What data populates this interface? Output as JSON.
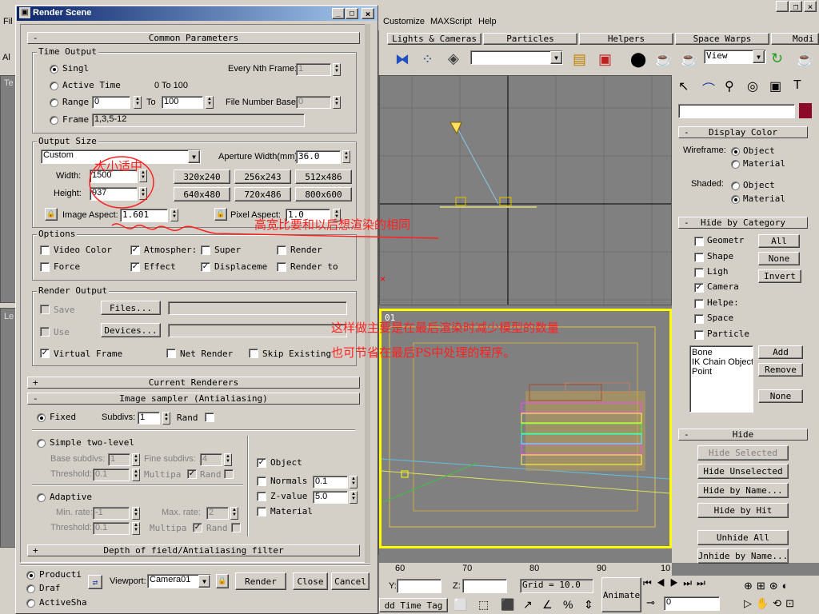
{
  "menu_items": [
    "Customize",
    "MAXScript",
    "Help"
  ],
  "app_left": {
    "file_stub": "Fil",
    "all_stub": "Al",
    "t_stub": "Te",
    "l_stub": "Le"
  },
  "tabs": [
    "Lights & Cameras",
    "Particles",
    "Helpers",
    "Space Warps",
    "Modi"
  ],
  "view_dropdown": "View",
  "main_buttons": {
    "minimize": "_",
    "restore": "❐",
    "close": "×"
  },
  "dialog": {
    "title": "Render Scene",
    "common_rollout": "Common Parameters",
    "time_output": {
      "title": "Time Output",
      "single": "Singl",
      "every_nth_label": "Every Nth Frame:",
      "every_nth_value": "1",
      "active_time": "Active Time",
      "active_range": "0 To 100",
      "range": "Range",
      "range_from": "0",
      "to_label": "To",
      "range_to": "100",
      "file_number_label": "File Number Base:",
      "file_number_value": "0",
      "frames": "Frame",
      "frames_value": "1,3,5-12"
    },
    "output_size": {
      "title": "Output Size",
      "preset": "Custom",
      "aperture_label": "Aperture Width(mm):",
      "aperture_value": "36.0",
      "width_label": "Width:",
      "width_value": "1500",
      "height_label": "Height:",
      "height_value": "937",
      "presets": [
        "320x240",
        "256x243",
        "512x486",
        "640x480",
        "720x486",
        "800x600"
      ],
      "image_aspect_label": "Image Aspect:",
      "image_aspect_value": "1.601",
      "pixel_aspect_label": "Pixel Aspect:",
      "pixel_aspect_value": "1.0"
    },
    "options": {
      "title": "Options",
      "items": [
        "Video Color",
        "Atmospher:",
        "Super",
        "Render",
        "Force",
        "Effect",
        "Displaceme",
        "Render to"
      ]
    },
    "render_output": {
      "title": "Render Output",
      "save": "Save",
      "files": "Files...",
      "use": "Use",
      "devices": "Devices...",
      "virtual_frame": "Virtual Frame",
      "net_render": "Net Render",
      "skip_existing": "Skip Existing"
    },
    "current_renderers": "Current Renderers",
    "image_sampler": {
      "title": "Image sampler (Antialiasing)",
      "fixed": "Fixed",
      "subdivs_label": "Subdivs:",
      "subdivs_value": "1",
      "rand": "Rand",
      "simple_two_level": "Simple two-level",
      "base_subdivs_label": "Base subdivs:",
      "base_subdivs_value": "1",
      "fine_subdivs_label": "Fine subdivs:",
      "fine_subdivs_value": "4",
      "threshold_label": "Threshold:",
      "threshold_value": "0.1",
      "multipa": "Multipa",
      "rand2": "Rand",
      "adaptive": "Adaptive",
      "min_rate_label": "Min. rate:",
      "min_rate_value": "-1",
      "max_rate_label": "Max. rate:",
      "max_rate_value": "2",
      "threshold2_value": "0.1",
      "object": "Object",
      "normals": "Normals",
      "normals_value": "0.1",
      "zvalue": "Z-value",
      "zvalue_value": "5.0",
      "material": "Material"
    },
    "depth_of_field": "Depth of field/Antialiasing filter",
    "bottom": {
      "production": "Producti",
      "draft": "Draf",
      "activeshade": "ActiveSha",
      "viewport_label": "Viewport:",
      "viewport_value": "Camera01",
      "render": "Render",
      "close": "Close",
      "cancel": "Cancel"
    }
  },
  "annotations": {
    "size_note": "大小适中",
    "ratio_note": "高宽比要和以后想渲染的相同",
    "reduce_note": "这样做主要是在最后渲染时减少模型的数量",
    "ps_note": "也可节省在最后PS中处理的程序。"
  },
  "viewport_label": "01",
  "timeline": {
    "ticks": [
      "60",
      "70",
      "80",
      "90",
      "10"
    ],
    "y_label": "Y:",
    "z_label": "Z:",
    "grid": "Grid = 10.0",
    "add_time_tag": "dd Time Tag",
    "animate": "Animate",
    "frame_value": "0"
  },
  "command_panel": {
    "display_color": {
      "title": "Display Color",
      "wireframe_label": "Wireframe:",
      "shaded_label": "Shaded:",
      "object": "Object",
      "material": "Material"
    },
    "hide_by_category": {
      "title": "Hide by Category",
      "items": [
        "Geometr",
        "Shape",
        "Ligh",
        "Camera",
        "Helpe:",
        "Space",
        "Particle"
      ],
      "all": "All",
      "none": "None",
      "invert": "Invert",
      "list": [
        "Bone",
        "IK Chain Object",
        "Point"
      ],
      "add": "Add",
      "remove": "Remove",
      "none2": "None"
    },
    "hide": {
      "title": "Hide",
      "hide_selected": "Hide Selected",
      "hide_unselected": "Hide Unselected",
      "hide_by_name": "Hide by Name...",
      "hide_by_hit": "Hide by Hit",
      "unhide_all": "Unhide All",
      "unhide_by_name": "Jnhide by Name..."
    }
  },
  "colors": {
    "accent_red": "#ff2020",
    "dialog_title": "#0a246a",
    "selection_yellow": "#ffff00",
    "swatch": "#8b0a2a"
  }
}
